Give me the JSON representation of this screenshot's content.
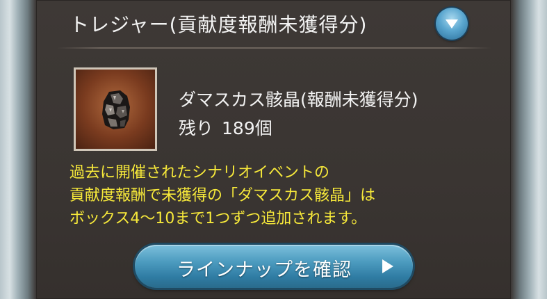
{
  "header": {
    "title": "トレジャー(貢献度報酬未獲得分)",
    "collapse_icon": "chevron-down-icon"
  },
  "item": {
    "name": "ダマスカス骸晶(報酬未獲得分)",
    "remaining_label": "残り",
    "remaining_value": "189個",
    "image_icon": "damascus-crystal-icon"
  },
  "notice": {
    "lines": [
      "過去に開催されたシナリオイベントの",
      "貢献度報酬で未獲得の「ダマスカス骸晶」は",
      "ボックス4〜10まで1つずつ追加されます。"
    ],
    "color": "#f7e93a"
  },
  "lineup_button": {
    "label": "ラインナップを確認",
    "icon": "play-arrow-icon",
    "accent": "#4c9bbf"
  }
}
